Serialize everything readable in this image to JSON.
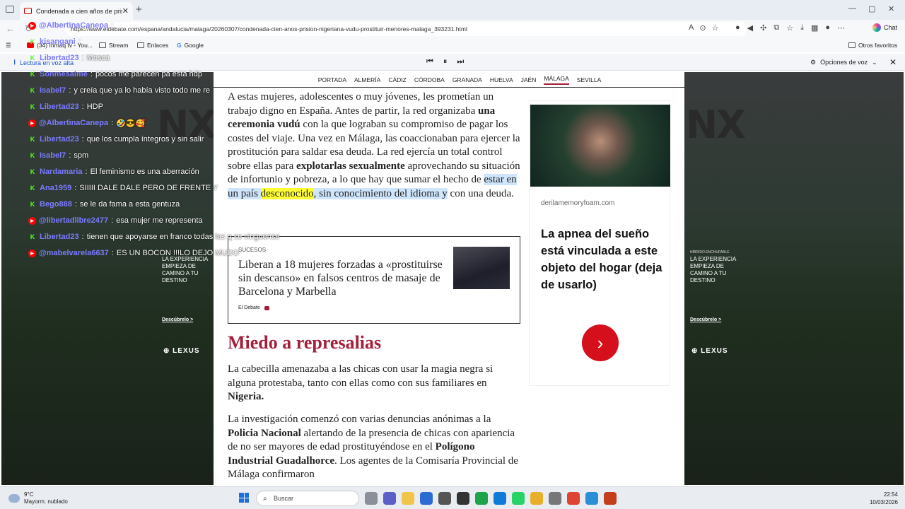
{
  "browser": {
    "tab_title": "Condenada a cien años de prisi",
    "url": "https://www.eldebate.com/espana/andalucia/malaga/20260307/condenada-cien-anos-prision-nigeriana-vudu-prostituir-menores-malaga_393231.html",
    "chat_label": "Chat",
    "favorites": [
      "(34) Inmaq tv - You...",
      "Stream",
      "Enlaces",
      "Google"
    ],
    "other_favorites": "Otros favoritos",
    "read_aloud_label": "Lectura en voz alta",
    "voice_options": "Opciones de voz"
  },
  "sections": [
    "PORTADA",
    "ALMERÍA",
    "CÁDIZ",
    "CÓRDOBA",
    "GRANADA",
    "HUELVA",
    "JAÉN",
    "MÁLAGA",
    "SEVILLA"
  ],
  "active_section": "MÁLAGA",
  "article": {
    "p1_a": "A estas mujeres, adolescentes o muy jóvenes, les prometían un trabajo digno en España. Antes de partir, la red organizaba ",
    "p1_b": "una ceremonia vudú",
    "p1_c": " con la que lograban su compromiso de pagar los costes del viaje. Una vez en Málaga, las coaccionaban para ejercer la prostitución para saldar esa deuda. La red ejercía un total control sobre ellas para ",
    "p1_d": "explotarlas sexualmente",
    "p1_e": " aprovechando su situación de infortunio y pobreza, a lo que hay que sumar el hecho de ",
    "p1_f": "estar en un país ",
    "p1_g": "desconocido",
    "p1_h": ", sin conocimiento del idioma y",
    "p1_i": " con una deuda.",
    "related_category": "SUCESOS",
    "related_title": "Liberan a 18 mujeres forzadas a «prostituirse sin descanso» en falsos centros de masaje de Barcelona y Marbella",
    "related_source": "El Debate",
    "heading": "Miedo a represalias",
    "p2_a": "La cabecilla amenazaba a las chicas con usar la magia negra si alguna protestaba, tanto con ellas como con sus familiares en ",
    "p2_b": "Nigeria.",
    "p3_a": "La investigación comenzó con varias denuncias anónimas a la ",
    "p3_b": "Policia Nacional",
    "p3_c": " alertando de la presencia de chicas con apariencia de no ser mayores de edad prostituyéndose en el ",
    "p3_d": "Polígono Industrial Guadalhorce",
    "p3_e": ". Los agentes de la Comisaría Provincial de Málaga confirmaron"
  },
  "ad": {
    "domain": "derilamemoryfoam.com",
    "headline": "La apnea del sueño está vinculada a este objeto del hogar (deja de usarlo)",
    "button_glyph": "›"
  },
  "side_ads": {
    "brand_mark": "NX",
    "tag": "LA EXPERIENCIA EMPIEZA DE CAMINO A TU DESTINO",
    "small_head": "HÍBRIDO ENCHUFABLE",
    "link": "Descúbrelo >",
    "lexus": "LEXUS"
  },
  "chat": [
    {
      "platform": "youtube",
      "user": "@AlbertinaCanepa",
      "text": ""
    },
    {
      "platform": "kick",
      "user": "kisangani",
      "text": ""
    },
    {
      "platform": "kick",
      "user": "Libertad23",
      "text": "Mosca"
    },
    {
      "platform": "kick",
      "user": "Sonmesalme",
      "text": "pocos me parecen pa esta hdp"
    },
    {
      "platform": "kick",
      "user": "Isabel7",
      "text": "y creía que ya lo había visto todo me re"
    },
    {
      "platform": "kick",
      "user": "Libertad23",
      "text": "HDP"
    },
    {
      "platform": "youtube",
      "user": "@AlbertinaCanepa",
      "text": "🤣😎🥰"
    },
    {
      "platform": "kick",
      "user": "Libertad23",
      "text": "que los cumpla íntegros y sin salir"
    },
    {
      "platform": "kick",
      "user": "Isabel7",
      "text": "spm"
    },
    {
      "platform": "kick",
      "user": "Nardamaria",
      "text": "El feminismo es una aberración"
    },
    {
      "platform": "kick",
      "user": "Ana1959",
      "text": "SIIIII DALE DALE PERO DE FRENTE Y"
    },
    {
      "platform": "kick",
      "user": "Bego888",
      "text": "se le da fama a esta gentuza"
    },
    {
      "platform": "youtube",
      "user": "@libertadlibre2477",
      "text": "esa mujer me representa"
    },
    {
      "platform": "kick",
      "user": "Libertad23",
      "text": "tienen que apoyarse en franco todas las q se vinguense"
    },
    {
      "platform": "youtube",
      "user": "@mabelvarela6637",
      "text": "ES UN BOCON !!!LO DEJO MUDO"
    }
  ],
  "taskbar": {
    "temp": "9°C",
    "weather": "Mayorm. nublado",
    "search": "Buscar",
    "time": "22:54",
    "date": "10/03/2026"
  },
  "colors": {
    "accent": "#a31f3a",
    "ad_button": "#d60f1c",
    "kick": "#53fc18",
    "youtube": "#ff0000",
    "chat_user": "#7b7bff",
    "highlight_line": "#cfe5fb",
    "highlight_word": "#ffff34"
  }
}
